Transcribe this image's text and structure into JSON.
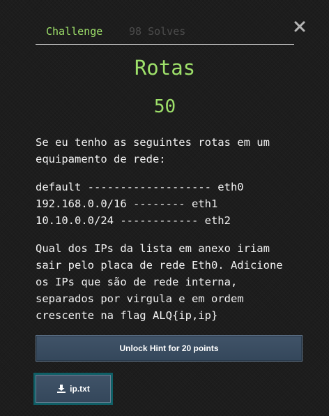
{
  "tabs": {
    "challenge_label": "Challenge",
    "solves_label": "98 Solves"
  },
  "challenge": {
    "title": "Rotas",
    "points": "50",
    "description": {
      "intro": "Se eu tenho as seguintes rotas em um\nequipamento de rede:",
      "routes": [
        "default ------------------- eth0",
        "192.168.0.0/16 -------- eth1",
        "10.10.0.0/24 ------------ eth2"
      ],
      "question": "Qual dos IPs da lista em anexo iriam\nsair pelo placa de rede Eth0. Adicione\nos IPs que são de rede interna,\nseparados por virgula e em ordem\ncrescente na flag ALQ{ip,ip}"
    }
  },
  "hint": {
    "label": "Unlock Hint for 20 points"
  },
  "files": [
    {
      "name": "ip.txt",
      "icon": "download-icon"
    }
  ],
  "colors": {
    "accent_green": "#9ee06a",
    "button_blue": "#3a4d61",
    "file_border_teal": "#0f5f66"
  }
}
